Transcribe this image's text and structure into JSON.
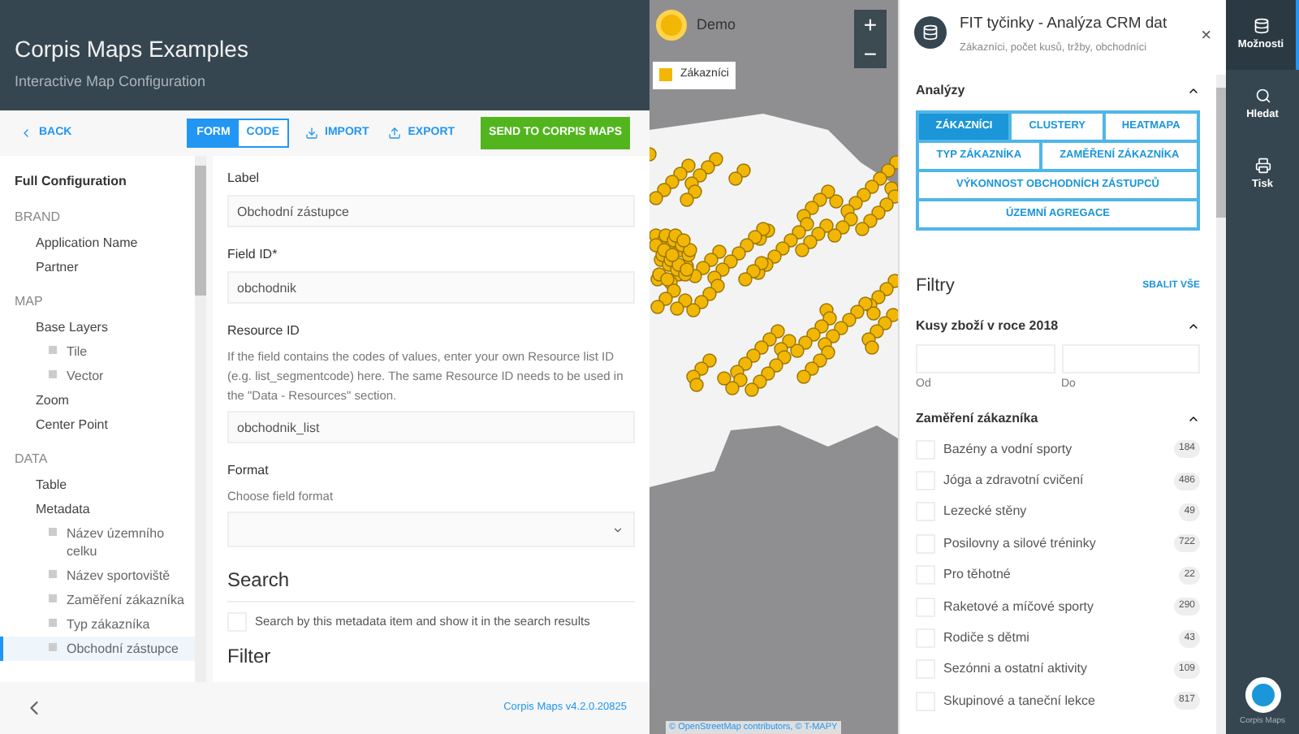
{
  "header": {
    "title": "Corpis Maps Examples",
    "subtitle": "Interactive Map Configuration"
  },
  "toolbar": {
    "back": "BACK",
    "modes": [
      {
        "label": "FORM",
        "selected": true
      },
      {
        "label": "CODE",
        "selected": false
      }
    ],
    "import": "IMPORT",
    "export": "EXPORT",
    "send": "SEND TO CORPIS MAPS"
  },
  "sidebar": {
    "title": "Full Configuration",
    "sections": [
      {
        "heading": "BRAND",
        "items": [
          {
            "label": "Application Name",
            "selected": false
          },
          {
            "label": "Partner",
            "selected": false
          }
        ]
      },
      {
        "heading": "MAP",
        "items": [
          {
            "label": "Base Layers",
            "selected": false,
            "children": [
              {
                "label": "Tile",
                "selected": false
              },
              {
                "label": "Vector",
                "selected": false
              }
            ]
          },
          {
            "label": "Zoom",
            "selected": false
          },
          {
            "label": "Center Point",
            "selected": false
          }
        ]
      },
      {
        "heading": "DATA",
        "items": [
          {
            "label": "Table",
            "selected": false
          },
          {
            "label": "Metadata",
            "selected": false,
            "children": [
              {
                "label": "Název územního celku",
                "selected": false
              },
              {
                "label": "Název sportoviště",
                "selected": false
              },
              {
                "label": "Zaměření zákazníka",
                "selected": false
              },
              {
                "label": "Typ zákazníka",
                "selected": false
              },
              {
                "label": "Obchodní zástupce",
                "selected": true
              }
            ]
          }
        ]
      }
    ]
  },
  "form": {
    "fields": [
      {
        "kind": "text",
        "label": "Label",
        "value": "Obchodní zástupce"
      },
      {
        "kind": "text",
        "label": "Field ID*",
        "value": "obchodnik"
      },
      {
        "kind": "text",
        "label": "Resource ID",
        "help": "If the field contains the codes of values, enter your own Resource list ID (e.g. list_segmentcode) here. The same Resource ID needs to be used in the \"Data - Resources\" section.",
        "value": "obchodnik_list"
      },
      {
        "kind": "select",
        "label": "Format",
        "help": "Choose field format"
      }
    ],
    "search": {
      "heading": "Search",
      "checkbox": {
        "label": "Search by this metadata item and show it in the search results",
        "checked": false
      }
    },
    "next_heading": "Filter"
  },
  "footer": {
    "version": "Corpis Maps v4.2.0.20825"
  },
  "map": {
    "title": "Demo",
    "zoom_in": "+",
    "zoom_out": "−",
    "legend": "Zákazníci",
    "attribution": "© OpenStreetMap contributors, © T-MAPY"
  },
  "panel": {
    "title": "FIT tyčinky - Analýza CRM dat",
    "subtitle": "Zákazníci, počet kusů, tržby, obchodníci",
    "close": "×",
    "analyses": {
      "heading": "Analýzy",
      "buttons": [
        [
          {
            "label": "ZÁKAZNÍCI",
            "selected": true
          },
          {
            "label": "CLUSTERY",
            "selected": false
          },
          {
            "label": "HEATMAPA",
            "selected": false
          }
        ],
        [
          {
            "label": "TYP ZÁKAZNÍKA",
            "selected": false
          },
          {
            "label": "ZAMĚŘENÍ ZÁKAZNÍKA",
            "selected": false
          }
        ],
        [
          {
            "label": "VÝKONNOST OBCHODNÍCH ZÁSTUPCŮ",
            "selected": false
          }
        ],
        [
          {
            "label": "ÚZEMNÍ AGREGACE",
            "selected": false
          }
        ]
      ]
    },
    "filters": {
      "heading": "Filtry",
      "collapse_all": "SBALIT VŠE",
      "range": {
        "heading": "Kusy zboží v roce 2018",
        "from": "Od",
        "to": "Do"
      },
      "list": {
        "heading": "Zaměření zákazníka",
        "items": [
          {
            "label": "Bazény a vodní sporty",
            "count": "184",
            "checked": false
          },
          {
            "label": "Jóga a zdravotní cvičení",
            "count": "486",
            "checked": false
          },
          {
            "label": "Lezecké stěny",
            "count": "49",
            "checked": false
          },
          {
            "label": "Posilovny a silové tréninky",
            "count": "722",
            "checked": false
          },
          {
            "label": "Pro těhotné",
            "count": "22",
            "checked": false
          },
          {
            "label": "Raketové a míčové sporty",
            "count": "290",
            "checked": false
          },
          {
            "label": "Rodiče s dětmi",
            "count": "43",
            "checked": false
          },
          {
            "label": "Sezónni a ostatní aktivity",
            "count": "109",
            "checked": false
          },
          {
            "label": "Skupinové a taneční lekce",
            "count": "817",
            "checked": false
          }
        ]
      }
    }
  },
  "rail": {
    "items": [
      {
        "label": "Možnosti",
        "selected": true,
        "kind": "options"
      },
      {
        "label": "Hledat",
        "selected": false,
        "kind": "search"
      },
      {
        "label": "Tisk",
        "selected": false,
        "kind": "print"
      }
    ],
    "brand": "Corpis Maps"
  }
}
